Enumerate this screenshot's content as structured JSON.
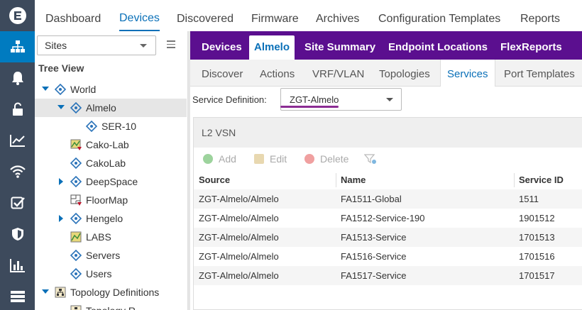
{
  "top_nav": {
    "tabs": [
      {
        "label": "Dashboard"
      },
      {
        "label": "Devices",
        "active": true
      },
      {
        "label": "Discovered"
      },
      {
        "label": "Firmware"
      },
      {
        "label": "Archives"
      },
      {
        "label": "Configuration Templates"
      },
      {
        "label": "Reports"
      }
    ]
  },
  "rail": {
    "icons": [
      "extreme-logo-icon",
      "network-icon",
      "bell-icon",
      "lock-icon",
      "chart-icon",
      "wifi-icon",
      "check-icon",
      "shield-icon",
      "bar-chart-icon",
      "server-icon"
    ]
  },
  "left_pane": {
    "site_select": {
      "value": "Sites"
    },
    "tree_title": "Tree View",
    "tree": [
      {
        "label": "World",
        "expand": "down",
        "icon": "site-icon",
        "selected": false
      },
      {
        "label": "Almelo",
        "expand": "down",
        "icon": "site-icon",
        "selected": true
      },
      {
        "label": "SER-10",
        "expand": "",
        "icon": "site-icon",
        "selected": false
      },
      {
        "label": "Cako-Lab",
        "expand": "",
        "icon": "map-alert-icon",
        "selected": false
      },
      {
        "label": "CakoLab",
        "expand": "",
        "icon": "site-icon",
        "selected": false
      },
      {
        "label": "DeepSpace",
        "expand": "right",
        "icon": "site-icon",
        "selected": false
      },
      {
        "label": "FloorMap",
        "expand": "",
        "icon": "floormap-alert-icon",
        "selected": false
      },
      {
        "label": "Hengelo",
        "expand": "right",
        "icon": "site-icon",
        "selected": false
      },
      {
        "label": "LABS",
        "expand": "",
        "icon": "map-icon",
        "selected": false
      },
      {
        "label": "Servers",
        "expand": "",
        "icon": "site-icon",
        "selected": false
      },
      {
        "label": "Users",
        "expand": "",
        "icon": "site-icon",
        "selected": false
      },
      {
        "label": "Topology Definitions",
        "expand": "down",
        "icon": "topology-icon",
        "selected": false
      },
      {
        "label": "Topology R",
        "expand": "",
        "icon": "topology-icon",
        "selected": false
      }
    ]
  },
  "device_tabs": [
    {
      "label": "Devices"
    },
    {
      "label": "Almelo",
      "active": true
    },
    {
      "label": "Site Summary"
    },
    {
      "label": "Endpoint Locations"
    },
    {
      "label": "FlexReports"
    }
  ],
  "sub_tabs": [
    {
      "label": "Discover"
    },
    {
      "label": "Actions"
    },
    {
      "label": "VRF/VLAN"
    },
    {
      "label": "Topologies"
    },
    {
      "label": "Services",
      "active": true
    },
    {
      "label": "Port Templates"
    }
  ],
  "service_definition": {
    "label": "Service Definition:",
    "value": "ZGT-Almelo"
  },
  "grid": {
    "title": "L2 VSN",
    "toolbar": {
      "add": "Add",
      "edit": "Edit",
      "delete": "Delete"
    },
    "columns": [
      "Source",
      "Name",
      "Service ID"
    ],
    "rows": [
      [
        "ZGT-Almelo/Almelo",
        "FA1511-Global",
        "1511"
      ],
      [
        "ZGT-Almelo/Almelo",
        "FA1512-Service-190",
        "1901512"
      ],
      [
        "ZGT-Almelo/Almelo",
        "FA1513-Service",
        "1701513"
      ],
      [
        "ZGT-Almelo/Almelo",
        "FA1516-Service",
        "1701516"
      ],
      [
        "ZGT-Almelo/Almelo",
        "FA1517-Service",
        "1701517"
      ]
    ]
  },
  "colors": {
    "accent": "#0a70b8",
    "purple_bar": "#5b0f8f",
    "rail": "#3d4a5c",
    "rail_active": "#007bc0",
    "underline": "#8b2d93"
  }
}
